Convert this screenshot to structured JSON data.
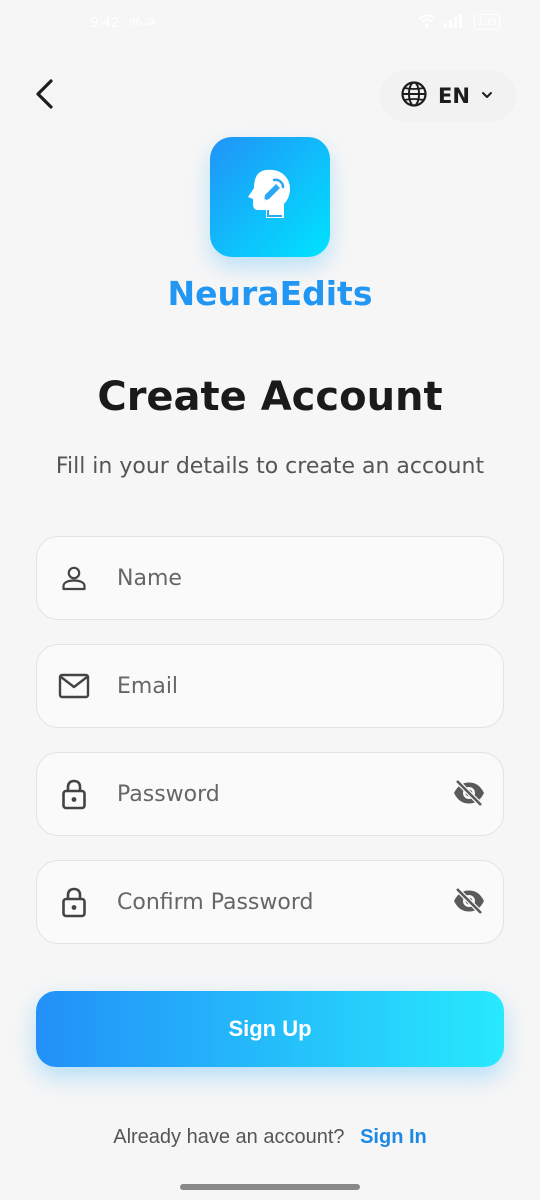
{
  "status_bar": {
    "time": "9:42",
    "network_speed": "96.3k",
    "battery": "100"
  },
  "header": {
    "language_label": "EN"
  },
  "app": {
    "name": "NeuraEdits",
    "icon": "head-pencil-icon"
  },
  "page": {
    "title": "Create Account",
    "subtitle": "Fill in your details to create an account"
  },
  "form": {
    "name_placeholder": "Name",
    "email_placeholder": "Email",
    "password_placeholder": "Password",
    "confirm_password_placeholder": "Confirm Password"
  },
  "actions": {
    "signup_label": "Sign Up",
    "signin_prompt": "Already have an account?",
    "signin_link": "Sign In"
  },
  "colors": {
    "accent": "#2196f3",
    "gradient_start": "#2290f8",
    "gradient_end": "#27e9fd",
    "background": "#f6f6f6"
  }
}
